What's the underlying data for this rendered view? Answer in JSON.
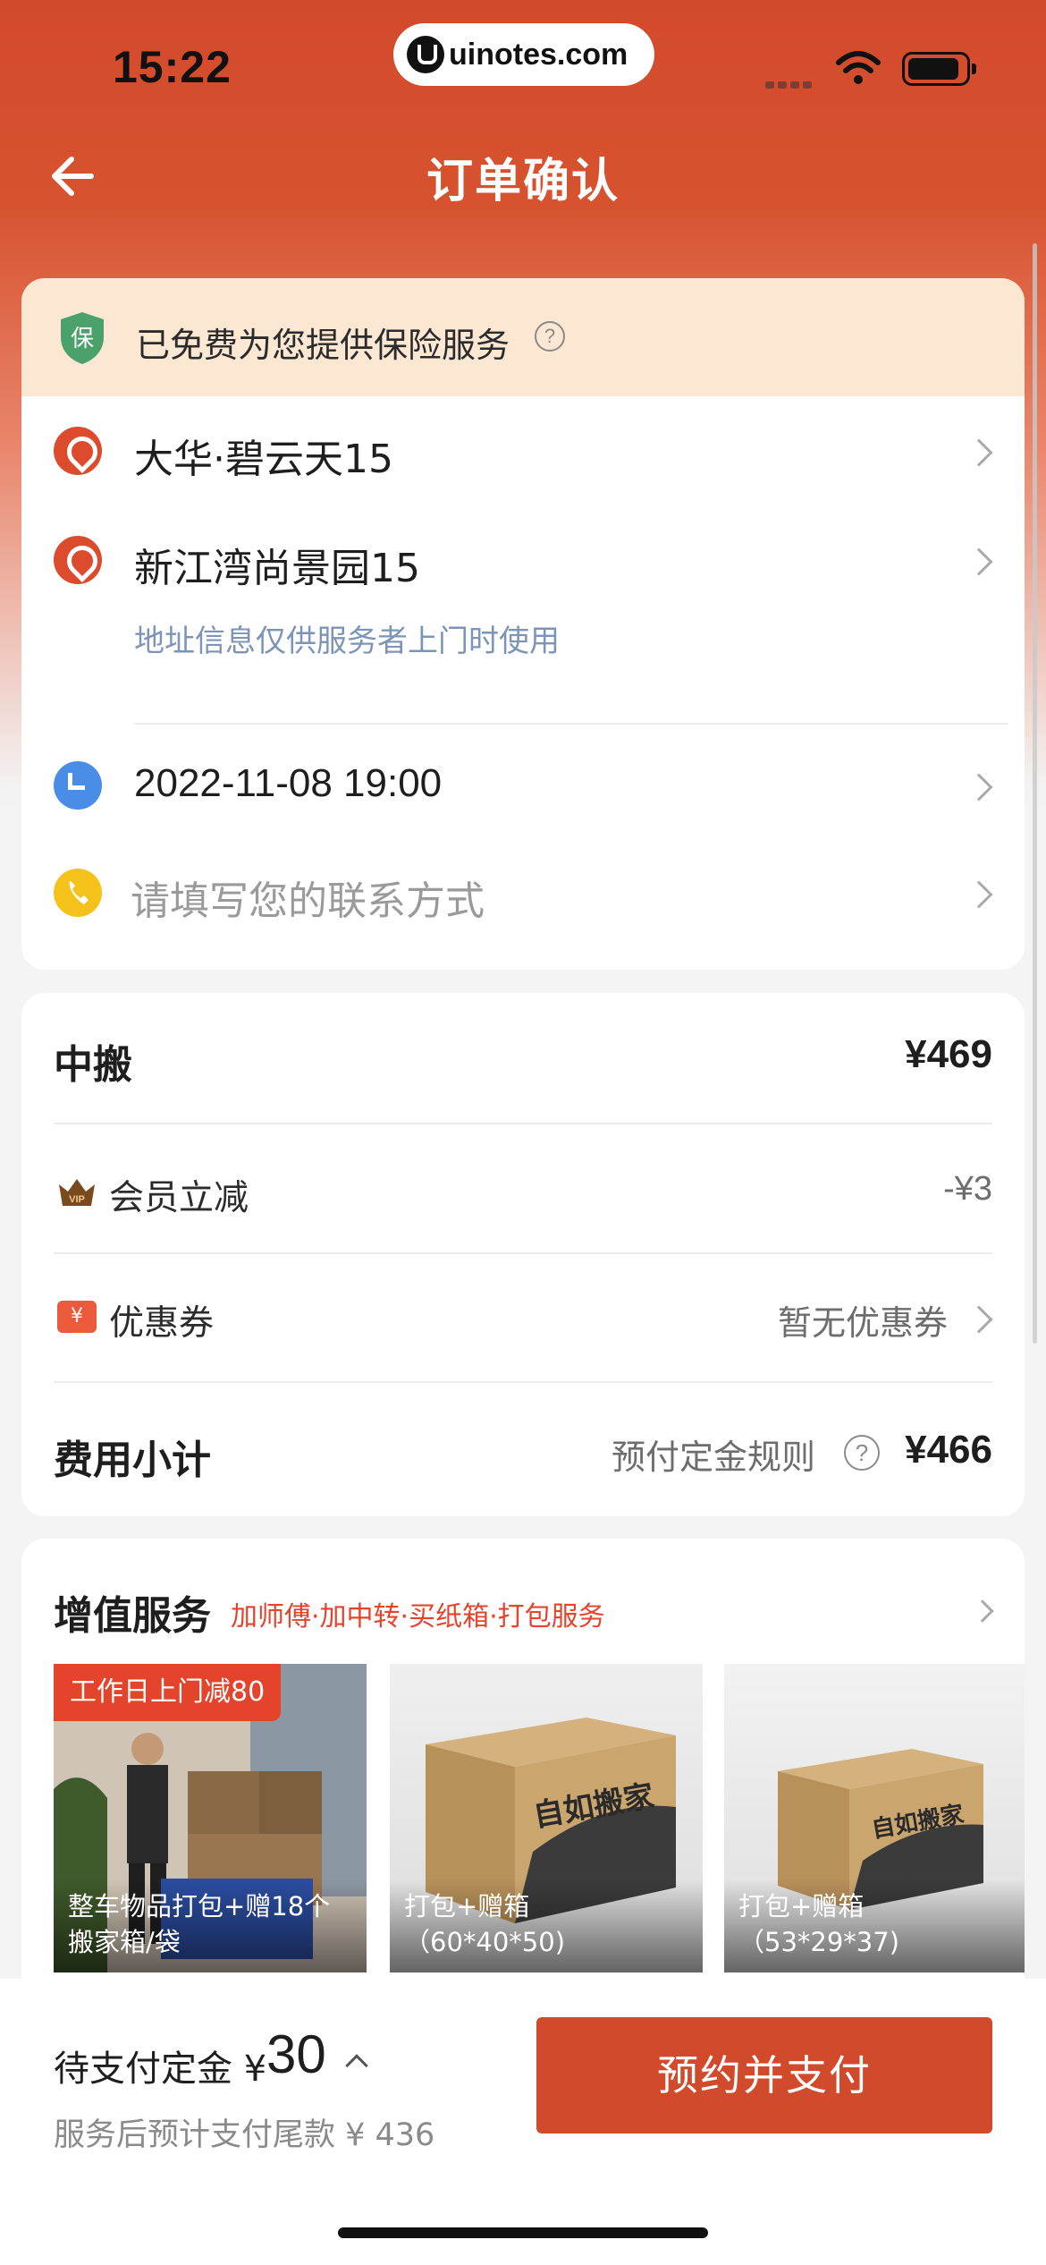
{
  "status_bar": {
    "time": "15:22",
    "url": "uinotes.com"
  },
  "header": {
    "title": "订单确认"
  },
  "insurance": {
    "text": "已免费为您提供保险服务",
    "help": "?",
    "badge": "保"
  },
  "addresses": [
    {
      "label": "大华·碧云天15"
    },
    {
      "label": "新江湾尚景园15"
    }
  ],
  "address_note": "地址信息仅供服务者上门时使用",
  "datetime": "2022-11-08 19:00",
  "contact_placeholder": "请填写您的联系方式",
  "fees": {
    "service": {
      "label": "中搬",
      "amount": "¥469"
    },
    "member": {
      "label": "会员立减",
      "amount": "-¥3",
      "icon_text": "VIP"
    },
    "coupon": {
      "label": "优惠券",
      "value": "暂无优惠券",
      "icon_text": "¥"
    },
    "subtotal": {
      "label": "费用小计",
      "rule": "预付定金规则",
      "help": "?",
      "amount": "¥466"
    }
  },
  "value_added": {
    "title": "增值服务",
    "subtitle": "加师傅·加中转·买纸箱·打包服务",
    "items": [
      {
        "tag": "工作日上门减80",
        "caption": "整车物品打包+赠18个搬家箱/袋",
        "box_text": ""
      },
      {
        "tag": "",
        "caption": "打包+赠箱（60*40*50)",
        "box_text": "自如搬家"
      },
      {
        "tag": "",
        "caption": "打包+赠箱（53*29*37)",
        "box_text": "自如搬家"
      }
    ]
  },
  "bottom": {
    "deposit_label": "待支付定金 ¥",
    "deposit_amount": "30",
    "balance_note": "服务后预计支付尾款 ¥ 436",
    "pay_button": "预约并支付"
  },
  "colors": {
    "brand": "#d24a2c",
    "insurance_bg": "#fbe7d2",
    "link_blue": "#7b94b8",
    "tag_red": "#e4432c"
  }
}
